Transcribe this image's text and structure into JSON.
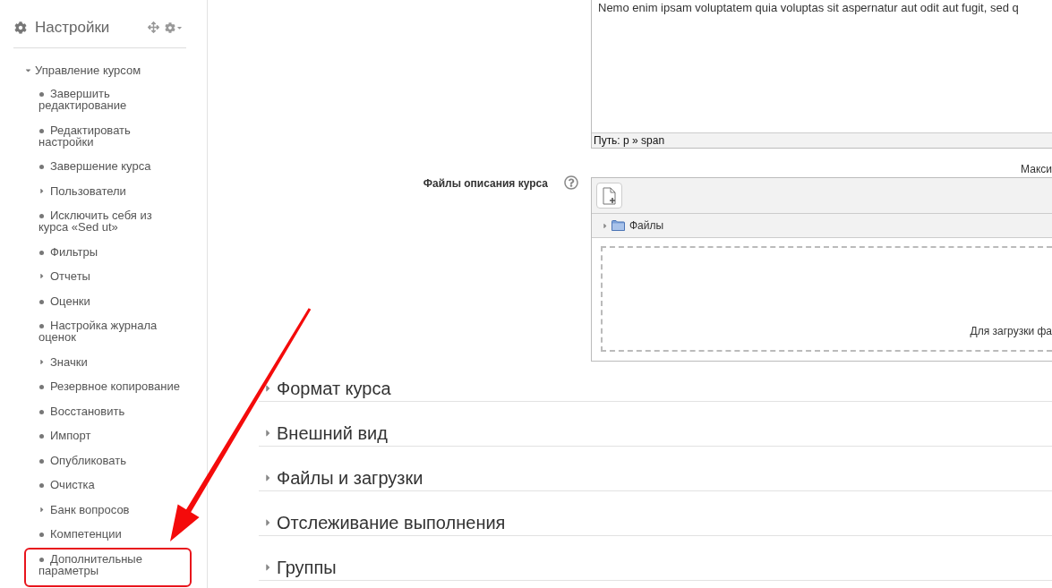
{
  "sidebar": {
    "title": "Настройки",
    "tree": {
      "label": "Управление курсом",
      "kind": "branch",
      "expanded": true,
      "children": [
        {
          "label": "Завершить редактирование",
          "kind": "leaf",
          "highlighted": false
        },
        {
          "label": "Редактировать настройки",
          "kind": "leaf",
          "highlighted": false
        },
        {
          "label": "Завершение курса",
          "kind": "leaf",
          "highlighted": false
        },
        {
          "label": "Пользователи",
          "kind": "branch",
          "expanded": false,
          "highlighted": false
        },
        {
          "label": "Исключить себя из курса «Sed ut»",
          "kind": "leaf",
          "highlighted": false
        },
        {
          "label": "Фильтры",
          "kind": "leaf",
          "highlighted": false
        },
        {
          "label": "Отчеты",
          "kind": "branch",
          "expanded": false,
          "highlighted": false
        },
        {
          "label": "Оценки",
          "kind": "leaf",
          "highlighted": false
        },
        {
          "label": "Настройка журнала оценок",
          "kind": "leaf",
          "highlighted": false
        },
        {
          "label": "Значки",
          "kind": "branch",
          "expanded": false,
          "highlighted": false
        },
        {
          "label": "Резервное копирование",
          "kind": "leaf",
          "highlighted": false
        },
        {
          "label": "Восстановить",
          "kind": "leaf",
          "highlighted": false
        },
        {
          "label": "Импорт",
          "kind": "leaf",
          "highlighted": false
        },
        {
          "label": "Опубликовать",
          "kind": "leaf",
          "highlighted": false
        },
        {
          "label": "Очистка",
          "kind": "leaf",
          "highlighted": false
        },
        {
          "label": "Банк вопросов",
          "kind": "branch",
          "expanded": false,
          "highlighted": false
        },
        {
          "label": "Компетенции",
          "kind": "leaf",
          "highlighted": false
        },
        {
          "label": "Дополнительные параметры",
          "kind": "leaf",
          "highlighted": true
        }
      ]
    }
  },
  "main": {
    "editor": {
      "text": "Nemo enim ipsam voluptatem quia voluptas sit aspernatur aut odit aut fugit, sed q",
      "path": "Путь: p » span"
    },
    "file_field": {
      "max_note": "Макси",
      "label": "Файлы описания курса",
      "folder": {
        "name": "Файлы",
        "expanded": false
      },
      "drop_hint": "Для загрузки фа"
    },
    "sections": [
      {
        "title": "Формат курса",
        "expanded": false
      },
      {
        "title": "Внешний вид",
        "expanded": false
      },
      {
        "title": "Файлы и загрузки",
        "expanded": false
      },
      {
        "title": "Отслеживание выполнения",
        "expanded": false
      },
      {
        "title": "Группы",
        "expanded": false
      }
    ]
  },
  "annotation": {
    "arrow": true
  }
}
